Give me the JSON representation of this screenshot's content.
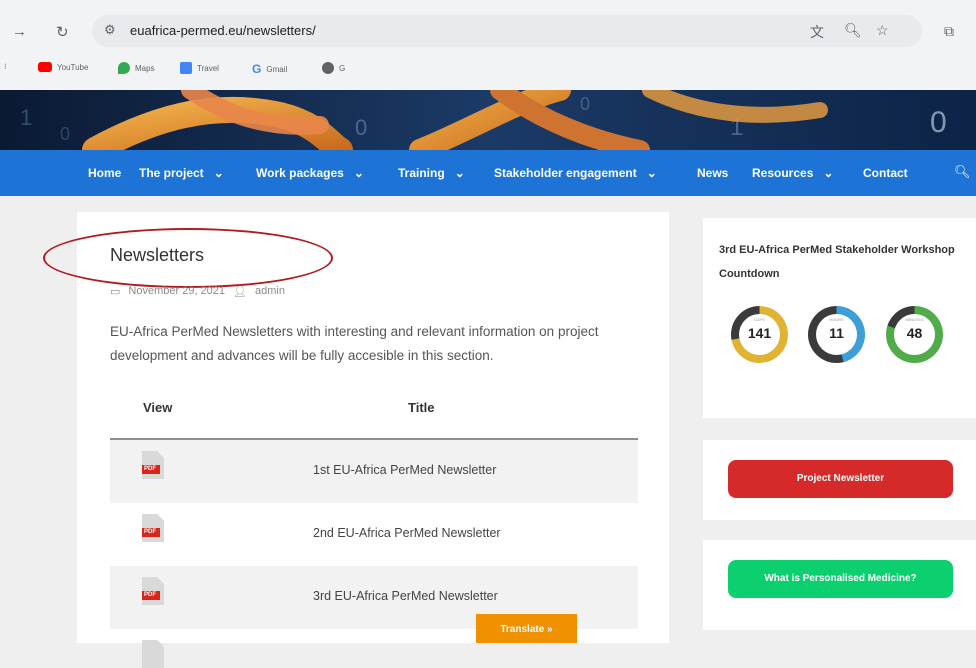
{
  "browser": {
    "url": "euafrica-permed.eu/newsletters/",
    "bookmarks": [
      {
        "label": "YouTube",
        "color": "#ff0000"
      },
      {
        "label": "Maps",
        "color": "#34a853"
      },
      {
        "label": "Travel",
        "color": "#4285f4"
      },
      {
        "label": "Gmail",
        "color": "#ffffff"
      },
      {
        "label": "G",
        "color": "#5f6368"
      }
    ]
  },
  "nav": {
    "items": [
      "Home",
      "The project",
      "Work packages",
      "Training",
      "Stakeholder engagement",
      "News",
      "Resources",
      "Contact"
    ],
    "dropdown_indicator": "⌄"
  },
  "page": {
    "title": "Newsletters",
    "date": "November 29, 2021",
    "author": "admin",
    "intro": "EU-Africa PerMed Newsletters with interesting and relevant information on project development and advances will be fully accesible in this section.",
    "table": {
      "headers": [
        "View",
        "Title"
      ],
      "rows": [
        {
          "icon": "PDF",
          "title": "1st EU-Africa PerMed Newsletter"
        },
        {
          "icon": "PDF",
          "title": "2nd EU-Africa PerMed Newsletter"
        },
        {
          "icon": "PDF",
          "title": "3rd EU-Africa PerMed Newsletter"
        }
      ]
    }
  },
  "translate": {
    "label": "Translate »"
  },
  "sidebar": {
    "countdown_title": "3rd EU-Africa PerMed Stakeholder Workshop Countdown",
    "countdown": [
      {
        "label": "DAYS",
        "value": "141",
        "color": "#e0b432"
      },
      {
        "label": "HOURS",
        "value": "11",
        "color": "#3e9ed8"
      },
      {
        "label": "MINUTES",
        "value": "48",
        "color": "#52ab4a"
      }
    ],
    "newsletter_button": "Project Newsletter",
    "personalised_button": "What is Personalised Medicine?"
  },
  "colors": {
    "nav_blue": "#1d74d6",
    "red_button": "#d62a2a",
    "green_button": "#0ccf6f",
    "translate_orange": "#ef9100"
  }
}
